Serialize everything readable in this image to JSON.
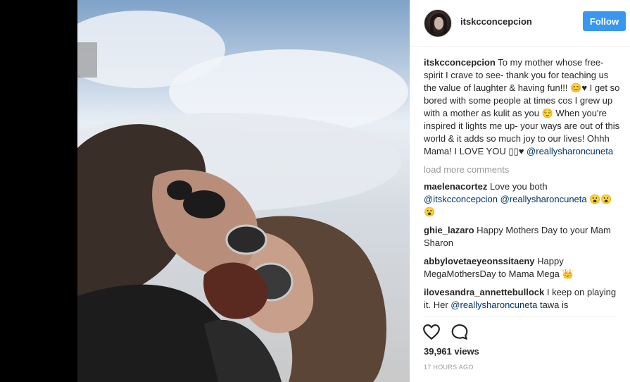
{
  "post": {
    "username": "itskcconcepcion",
    "follow_label": "Follow",
    "caption_username": "itskcconcepcion",
    "caption_text": " To my mother whose free-spirit I crave to see- thank you for teaching us the value of laughter & having fun!!! 😊♥ I get so bored with some people at times cos I grew up with a mother as kulit as you 😌 When you're inspired it lights me up- your ways are out of this world & it adds so much joy to our lives! Ohhh Mama! I LOVE YOU ▯▯♥ ",
    "caption_mention": "@reallysharoncuneta",
    "load_more": "load more comments",
    "comments": [
      {
        "user": "maelenacortez",
        "text": " Love you both ",
        "mention1": "@itskcconcepcion",
        "mention2": " @reallysharoncuneta",
        "tail": " 😮😮😮"
      },
      {
        "user": "ghie_lazaro",
        "text": " Happy Mothers Day to your Mam Sharon"
      },
      {
        "user": "abbylovetaeyeonssitaeny",
        "text": " Happy MegaMothersDay to Mama Mega 👑"
      },
      {
        "user": "ilovesandra_annettebullock",
        "text": " I keep on playing it. Her ",
        "mention1": "@reallysharoncuneta",
        "tail": " tawa is"
      }
    ],
    "views": "39,961 views",
    "timestamp": "17 HOURS AGO"
  },
  "icons": {
    "like": "heart-icon",
    "comment": "speech-bubble-icon"
  },
  "colors": {
    "follow_button": "#3897f0",
    "mention": "#003569",
    "muted": "#999999"
  }
}
